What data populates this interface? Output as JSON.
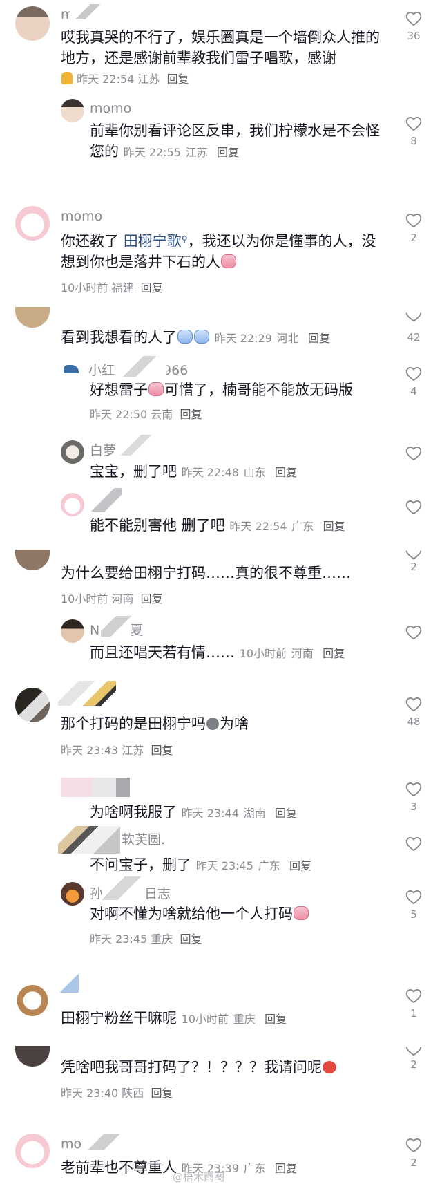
{
  "comments": [
    {
      "name": "m",
      "text": "哎我真哭的不行了，娱乐圈真是一个墙倒众人推的地方，还是感谢前辈教我们雷子唱歌，感谢",
      "time": "昨天 22:54",
      "loc": "江苏",
      "reply": "回复",
      "likes": "36"
    },
    {
      "name": "momo",
      "text": "前辈你别看评论区反串，我们柠檬水是不会怪您的",
      "time": "昨天 22:55",
      "loc": "江苏",
      "reply": "回复",
      "likes": "8"
    },
    {
      "name": "momo",
      "text_a": "你还教了 ",
      "mention": "田栩宁歌",
      "text_b": "，我还以为你是懂事的人，没想到你也是落井下石的人",
      "time": "10小时前",
      "loc": "福建",
      "reply": "回复",
      "likes": "2"
    },
    {
      "name": "",
      "text": "看到我想看的人了",
      "time": "昨天 22:29",
      "loc": "河北",
      "reply": "回复",
      "likes": "42"
    },
    {
      "name_a": "小红",
      "name_b": "966",
      "text_a": "好想雷子",
      "text_b": "可惜了，楠哥能不能放无码版",
      "time": "昨天 22:50",
      "loc": "云南",
      "reply": "回复",
      "likes": "4"
    },
    {
      "name": "白萝",
      "text": "宝宝，删了吧",
      "time": "昨天 22:48",
      "loc": "山东",
      "reply": "回复"
    },
    {
      "name": "",
      "text": "能不能别害他 删了吧",
      "time": "昨天 22:54",
      "loc": "广东",
      "reply": "回复"
    },
    {
      "name": "",
      "text": "为什么要给田栩宁打码……真的很不尊重……",
      "time": "10小时前",
      "loc": "河南",
      "reply": "回复",
      "likes": "2"
    },
    {
      "name_a": "N",
      "name_b": "夏",
      "text": "而且还唱天若有情……",
      "time": "10小时前",
      "loc": "河南",
      "reply": "回复"
    },
    {
      "name": "",
      "text_a": "那个打码的是田栩宁吗",
      "text_b": "为啥",
      "time": "昨天 23:43",
      "loc": "江苏",
      "reply": "回复",
      "likes": "48"
    },
    {
      "name": "",
      "text": "为啥啊我服了",
      "time": "昨天 23:44",
      "loc": "湖南",
      "reply": "回复",
      "likes": "3"
    },
    {
      "name": "软芙圆.",
      "text": "不问宝子，删了",
      "time": "昨天 23:45",
      "loc": "广东",
      "reply": "回复"
    },
    {
      "name_a": "孙",
      "name_b": "日志",
      "text": "对啊不懂为啥就给他一个人打码",
      "time": "昨天 23:45",
      "loc": "重庆",
      "reply": "回复",
      "likes": "5"
    },
    {
      "name": "",
      "text": "田栩宁粉丝干嘛呢",
      "time": "10小时前",
      "loc": "重庆",
      "reply": "回复",
      "likes": "1"
    },
    {
      "name": "",
      "text": "凭啥吧我哥哥打码了？！？？？我请问呢",
      "time": "昨天 23:40",
      "loc": "陕西",
      "reply": "回复",
      "likes": "2"
    },
    {
      "name": "mo",
      "text": "老前辈也不尊重人",
      "time": "昨天 23:39",
      "loc": "广东",
      "reply": "回复",
      "likes": "2"
    }
  ],
  "watermark": "@梧木雨图",
  "colors": {
    "text": "#161823",
    "meta": "#8a8b91",
    "mention": "#2d4f83",
    "icon": "#8a8b91"
  }
}
